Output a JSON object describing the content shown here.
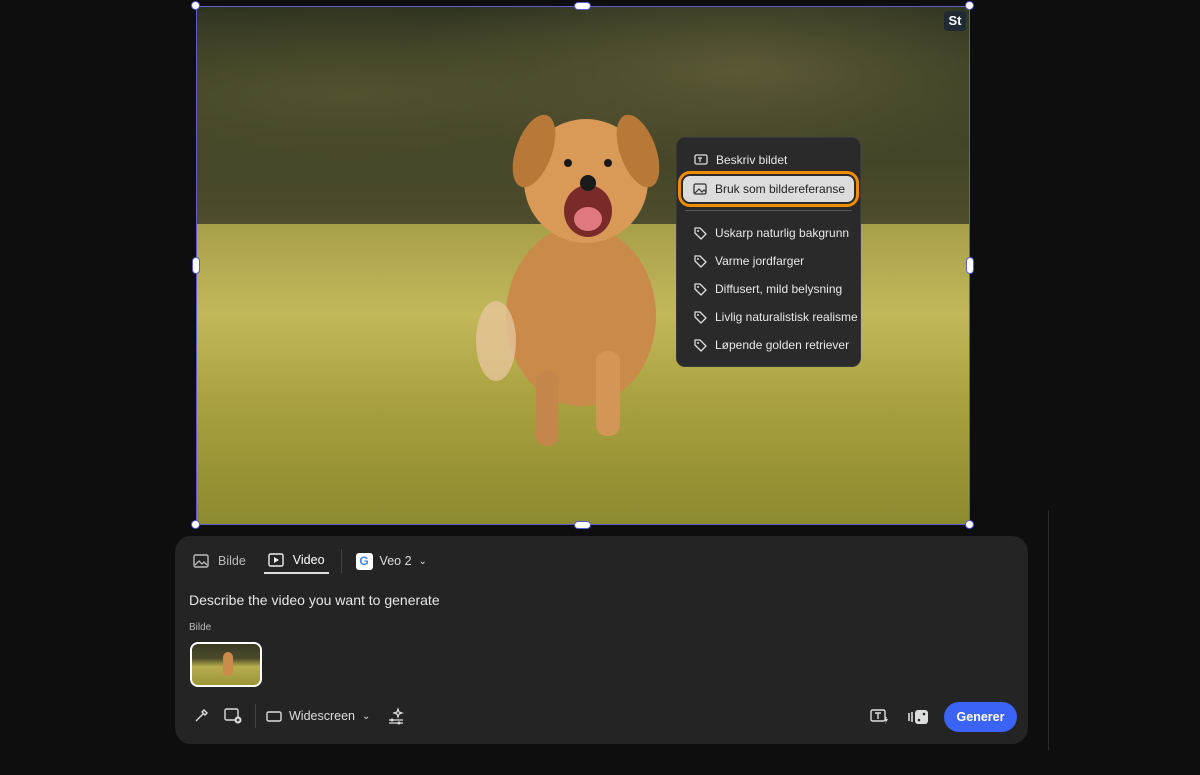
{
  "canvas": {
    "badge": "St"
  },
  "context_menu": {
    "describe": "Beskriv bildet",
    "use_as_reference": "Bruk som bildereferanse",
    "tags": [
      "Uskarp naturlig bakgrunn",
      "Varme jordfarger",
      "Diffusert, mild belysning",
      "Livlig naturalistisk realisme",
      "Løpende golden retriever"
    ]
  },
  "panel": {
    "tabs": [
      {
        "label": "Bilde"
      },
      {
        "label": "Video"
      }
    ],
    "model": {
      "logo": "G",
      "label": "Veo 2"
    },
    "prompt_placeholder": "Describe the video you want to generate",
    "image_label": "Bilde",
    "aspect": "Widescreen",
    "generate": "Generer"
  },
  "colors": {
    "accent": "#3b63f6",
    "highlight": "#f08c00",
    "selection": "#5b5bd6"
  }
}
